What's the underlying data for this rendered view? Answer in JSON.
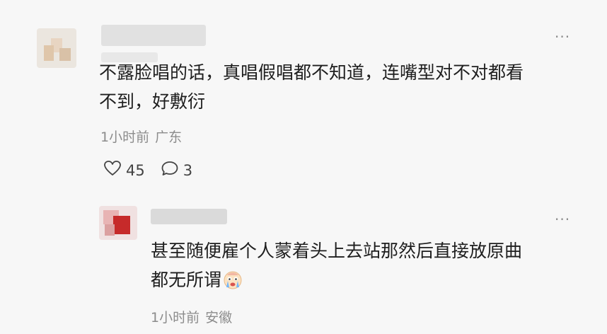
{
  "comments": [
    {
      "text_line1": "不露脸唱的话，真唱假唱都不知道，连嘴型对不对都看",
      "text_line2": "不到，好敷衍",
      "time": "1小时前",
      "location": "广东",
      "likes": "45",
      "replies": "3",
      "more": "···"
    },
    {
      "text_line1": "甚至随便雇个人蒙着头上去站那然后直接放原曲",
      "text_line2": "都无所谓",
      "time": "1小时前",
      "location": "安徽",
      "more": "···"
    }
  ],
  "icons": {
    "like": "heart-icon",
    "reply": "comment-bubble-icon",
    "emoji": "crying-face-emoji"
  }
}
